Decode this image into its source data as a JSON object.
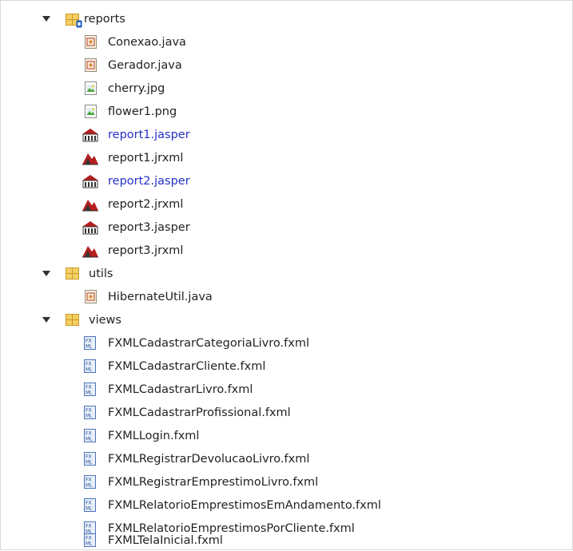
{
  "tree": {
    "reports": {
      "label": "reports",
      "files": [
        {
          "name": "Conexao.java",
          "icon": "java-file-icon"
        },
        {
          "name": "Gerador.java",
          "icon": "java-file-icon"
        },
        {
          "name": "cherry.jpg",
          "icon": "image-file-icon"
        },
        {
          "name": "flower1.png",
          "icon": "image-file-icon"
        },
        {
          "name": "report1.jasper",
          "icon": "jasper-file-icon",
          "modified": true
        },
        {
          "name": "report1.jrxml",
          "icon": "jrxml-file-icon"
        },
        {
          "name": "report2.jasper",
          "icon": "jasper-file-icon",
          "modified": true
        },
        {
          "name": "report2.jrxml",
          "icon": "jrxml-file-icon"
        },
        {
          "name": "report3.jasper",
          "icon": "jasper-file-icon",
          "modified": false
        },
        {
          "name": "report3.jrxml",
          "icon": "jrxml-file-icon"
        }
      ]
    },
    "utils": {
      "label": "utils",
      "files": [
        {
          "name": "HibernateUtil.java",
          "icon": "java-file-icon"
        }
      ]
    },
    "views": {
      "label": "views",
      "files": [
        {
          "name": "FXMLCadastrarCategoriaLivro.fxml",
          "icon": "fxml-file-icon"
        },
        {
          "name": "FXMLCadastrarCliente.fxml",
          "icon": "fxml-file-icon"
        },
        {
          "name": "FXMLCadastrarLivro.fxml",
          "icon": "fxml-file-icon"
        },
        {
          "name": "FXMLCadastrarProfissional.fxml",
          "icon": "fxml-file-icon"
        },
        {
          "name": "FXMLLogin.fxml",
          "icon": "fxml-file-icon"
        },
        {
          "name": "FXMLRegistrarDevolucaoLivro.fxml",
          "icon": "fxml-file-icon"
        },
        {
          "name": "FXMLRegistrarEmprestimoLivro.fxml",
          "icon": "fxml-file-icon"
        },
        {
          "name": "FXMLRelatorioEmprestimosEmAndamento.fxml",
          "icon": "fxml-file-icon"
        },
        {
          "name": "FXMLRelatorioEmprestimosPorCliente.fxml",
          "icon": "fxml-file-icon"
        },
        {
          "name": "FXMLTelaInicial.fxml",
          "icon": "fxml-file-icon"
        }
      ]
    }
  },
  "colors": {
    "modified_text": "#2330c8",
    "package_fill": "#f4cf63",
    "package_stroke": "#c99a25"
  }
}
